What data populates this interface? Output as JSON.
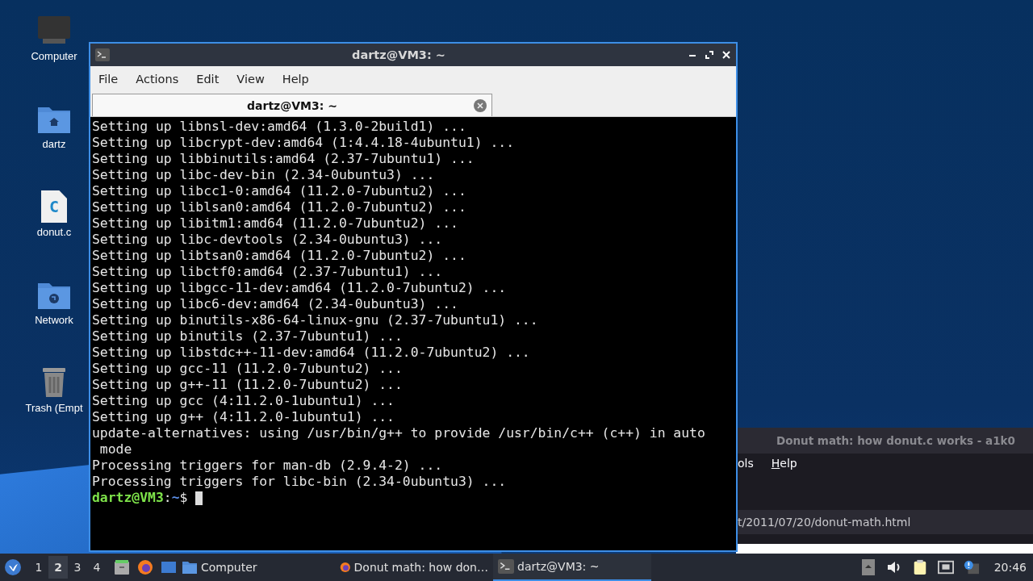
{
  "desktop_icons": [
    {
      "label": "Computer",
      "kind": "computer"
    },
    {
      "label": "dartz",
      "kind": "home"
    },
    {
      "label": "donut.c",
      "kind": "c-file",
      "glyph": "C"
    },
    {
      "label": "Network",
      "kind": "network"
    },
    {
      "label": "Trash (Empt",
      "kind": "trash"
    }
  ],
  "browser_window": {
    "title": "Donut math: how donut.c works - a1k0",
    "menu": [
      {
        "label": "ols",
        "underline_first": false
      },
      {
        "label": "Help",
        "underline_first": true
      }
    ],
    "url": "t/2011/07/20/donut-math.html"
  },
  "terminal_window": {
    "title": "dartz@VM3: ~",
    "menu": [
      "File",
      "Actions",
      "Edit",
      "View",
      "Help"
    ],
    "tabs": [
      {
        "label": "dartz@VM3: ~",
        "selected": true
      }
    ],
    "lines": [
      "Setting up libnsl-dev:amd64 (1.3.0-2build1) ...",
      "Setting up libcrypt-dev:amd64 (1:4.4.18-4ubuntu1) ...",
      "Setting up libbinutils:amd64 (2.37-7ubuntu1) ...",
      "Setting up libc-dev-bin (2.34-0ubuntu3) ...",
      "Setting up libcc1-0:amd64 (11.2.0-7ubuntu2) ...",
      "Setting up liblsan0:amd64 (11.2.0-7ubuntu2) ...",
      "Setting up libitm1:amd64 (11.2.0-7ubuntu2) ...",
      "Setting up libc-devtools (2.34-0ubuntu3) ...",
      "Setting up libtsan0:amd64 (11.2.0-7ubuntu2) ...",
      "Setting up libctf0:amd64 (2.37-7ubuntu1) ...",
      "Setting up libgcc-11-dev:amd64 (11.2.0-7ubuntu2) ...",
      "Setting up libc6-dev:amd64 (2.34-0ubuntu3) ...",
      "Setting up binutils-x86-64-linux-gnu (2.37-7ubuntu1) ...",
      "Setting up binutils (2.37-7ubuntu1) ...",
      "Setting up libstdc++-11-dev:amd64 (11.2.0-7ubuntu2) ...",
      "Setting up gcc-11 (11.2.0-7ubuntu2) ...",
      "Setting up g++-11 (11.2.0-7ubuntu2) ...",
      "Setting up gcc (4:11.2.0-1ubuntu1) ...",
      "Setting up g++ (4:11.2.0-1ubuntu1) ...",
      "update-alternatives: using /usr/bin/g++ to provide /usr/bin/c++ (c++) in auto",
      " mode",
      "Processing triggers for man-db (2.9.4-2) ...",
      "Processing triggers for libc-bin (2.34-0ubuntu3) ..."
    ],
    "prompt": {
      "user_host": "dartz@VM3",
      "separator": ":",
      "path": "~",
      "symbol": "$"
    }
  },
  "taskbar": {
    "workspaces": [
      {
        "label": "1",
        "selected": false
      },
      {
        "label": "2",
        "selected": true
      },
      {
        "label": "3",
        "selected": false
      },
      {
        "label": "4",
        "selected": false
      }
    ],
    "tasks": [
      {
        "label": "Computer",
        "kind": "folder",
        "selected": false
      },
      {
        "label": "Donut math: how don…",
        "kind": "firefox",
        "selected": false
      },
      {
        "label": "dartz@VM3: ~",
        "kind": "terminal",
        "selected": true
      }
    ],
    "clock": "20:46"
  }
}
